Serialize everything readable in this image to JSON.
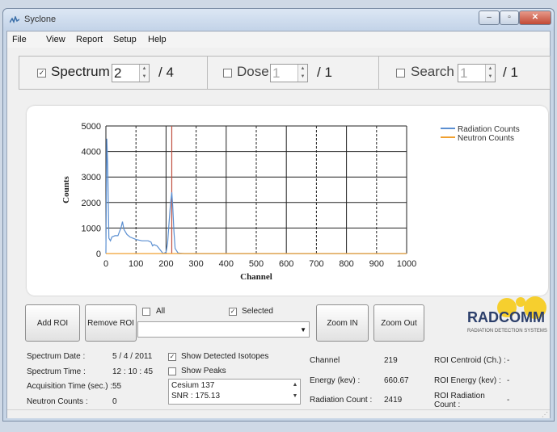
{
  "window": {
    "title": "Syclone",
    "min_label": "–",
    "max_label": "▫",
    "close_label": "✕"
  },
  "menu": [
    "File",
    "View",
    "Report",
    "Setup",
    "Help"
  ],
  "modes": [
    {
      "name": "Spectrum",
      "checked": true,
      "value": "2",
      "total": "/ 4",
      "enabled": true
    },
    {
      "name": "Dose",
      "checked": false,
      "value": "1",
      "total": "/ 1",
      "enabled": false
    },
    {
      "name": "Search",
      "checked": false,
      "value": "1",
      "total": "/ 1",
      "enabled": false
    }
  ],
  "chart_data": {
    "type": "line",
    "xlabel": "Channel",
    "ylabel": "Counts",
    "xlim": [
      0,
      1000
    ],
    "ylim": [
      0,
      5000
    ],
    "x_ticks": [
      0,
      100,
      200,
      300,
      400,
      500,
      600,
      700,
      800,
      900,
      1000
    ],
    "y_ticks": [
      0,
      1000,
      2000,
      3000,
      4000,
      5000
    ],
    "grid": true,
    "legend_position": "top-right",
    "series": [
      {
        "name": "Radiation Counts",
        "color": "#5b8fd1",
        "x": [
          0,
          3,
          6,
          10,
          15,
          20,
          30,
          40,
          45,
          50,
          55,
          60,
          70,
          80,
          100,
          120,
          140,
          150,
          155,
          160,
          170,
          180,
          190,
          200,
          205,
          210,
          215,
          219,
          222,
          226,
          230,
          240,
          260,
          300,
          400,
          500,
          600,
          700,
          800,
          900,
          1000
        ],
        "y": [
          0,
          4500,
          3500,
          600,
          500,
          650,
          700,
          700,
          850,
          1000,
          1250,
          950,
          750,
          650,
          550,
          500,
          500,
          450,
          300,
          350,
          300,
          150,
          0,
          50,
          400,
          1200,
          2000,
          2400,
          1900,
          900,
          200,
          20,
          0,
          0,
          0,
          0,
          0,
          0,
          0,
          0,
          0
        ]
      },
      {
        "name": "Neutron Counts",
        "color": "#f0a030",
        "x": [
          0,
          1000
        ],
        "y": [
          0,
          0
        ]
      }
    ],
    "roi_markers": [
      {
        "channel": 219,
        "color": "#c05040"
      }
    ]
  },
  "roi": {
    "add_label": "Add ROI",
    "remove_label": "Remove ROI",
    "all_label": "All",
    "all_checked": false,
    "selected_label": "Selected",
    "selected_checked": true,
    "dropdown_value": ""
  },
  "zoom": {
    "in_label": "Zoom IN",
    "out_label": "Zoom Out"
  },
  "logo": {
    "main": "RADCOMM",
    "sub": "RADIATION DETECTION SYSTEMS"
  },
  "info": {
    "spectrum_date_label": "Spectrum Date :",
    "spectrum_date": "5 / 4 / 2011",
    "spectrum_time_label": "Spectrum Time :",
    "spectrum_time": "12 : 10 : 45",
    "acq_time_label": "Acquisition Time (sec.) :",
    "acq_time": "55",
    "neutron_label": "Neutron Counts :",
    "neutron": "0"
  },
  "isotopes": {
    "show_detected_label": "Show Detected Isotopes",
    "show_detected_checked": true,
    "show_peaks_label": "Show Peaks",
    "show_peaks_checked": false,
    "list": [
      "Cesium 137",
      "SNR : 175.13"
    ]
  },
  "readout": {
    "channel_label": "Channel",
    "channel": "219",
    "energy_label": "Energy (kev) :",
    "energy": "660.67",
    "rad_count_label": "Radiation Count :",
    "rad_count": "2419",
    "centroid_label": "ROI Centroid (Ch.) :",
    "centroid": "-",
    "roi_energy_label": "ROI Energy (kev) :",
    "roi_energy": "-",
    "roi_rad_label": "ROI Radiation Count :",
    "roi_rad": "-"
  }
}
